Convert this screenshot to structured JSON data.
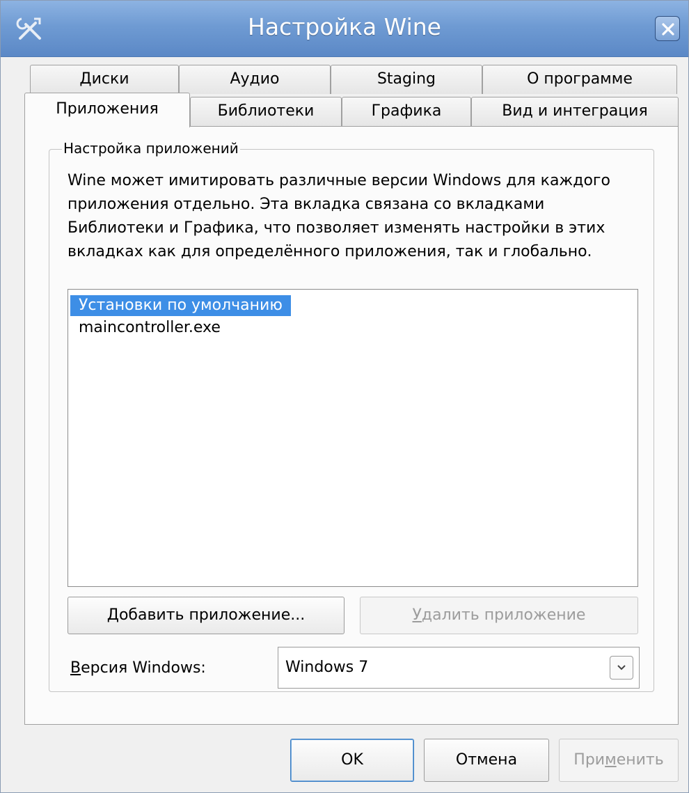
{
  "window": {
    "title": "Настройка Wine",
    "icon": "tools-icon",
    "close_icon": "close-icon"
  },
  "tabs_row1": [
    {
      "label": "Диски"
    },
    {
      "label": "Аудио"
    },
    {
      "label": "Staging"
    },
    {
      "label": "О программе"
    }
  ],
  "tabs_row2": [
    {
      "label": "Приложения",
      "active": true
    },
    {
      "label": "Библиотеки"
    },
    {
      "label": "Графика"
    },
    {
      "label": "Вид и интеграция"
    }
  ],
  "group": {
    "title": "Настройка приложений",
    "description": "Wine может имитировать различные версии Windows для каждого приложения отдельно. Эта вкладка связана со вкладками Библиотеки и Графика, что позволяет изменять настройки в этих вкладках как для определённого приложения, так и глобально."
  },
  "app_list": [
    {
      "label": "Установки по умолчанию",
      "selected": true
    },
    {
      "label": "maincontroller.exe",
      "selected": false
    }
  ],
  "buttons": {
    "add_app_first": "Д",
    "add_app_rest": "обавить приложение...",
    "remove_app_first": "У",
    "remove_app_rest": "далить приложение",
    "remove_app_disabled": true
  },
  "windows_version": {
    "label_first": "В",
    "label_rest": "ерсия Windows:",
    "selected": "Windows 7"
  },
  "footer": {
    "ok": "OK",
    "cancel": "Отмена",
    "apply_a": "При",
    "apply_u": "м",
    "apply_b": "енить",
    "apply_disabled": true
  }
}
